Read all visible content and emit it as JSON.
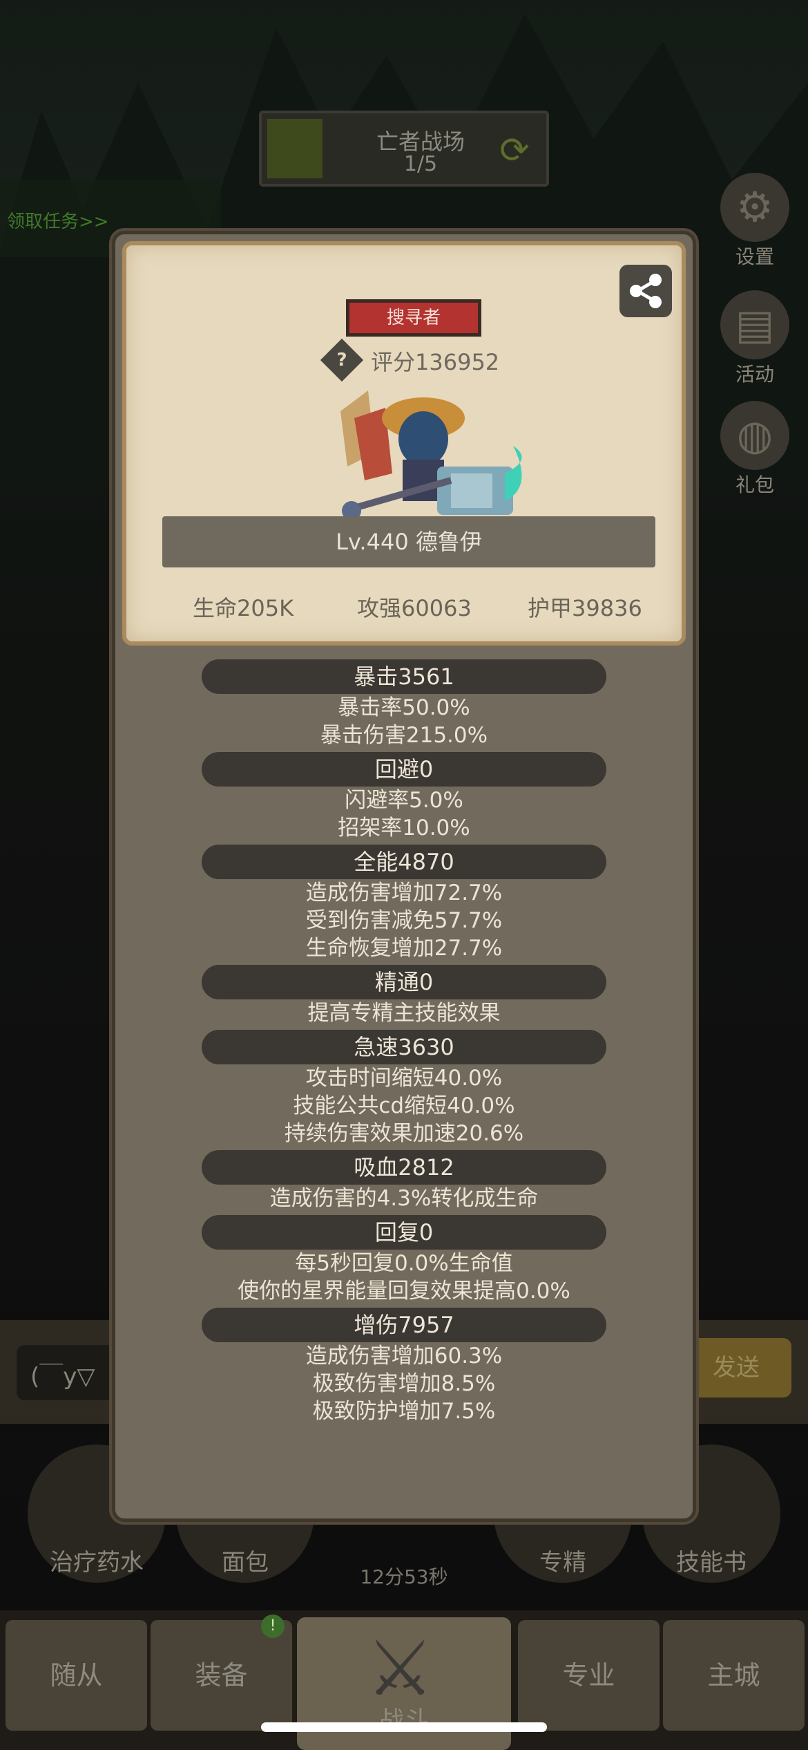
{
  "stage": {
    "title": "亡者战场",
    "progress": "1/5"
  },
  "task_link": "领取任务>>",
  "side_buttons": [
    {
      "label": "设置",
      "icon": "gear-icon"
    },
    {
      "label": "活动",
      "icon": "scroll-icon"
    },
    {
      "label": "礼包",
      "icon": "gift-icon"
    }
  ],
  "chat": {
    "input_text": "(￣y▽",
    "send_label": "发送"
  },
  "items": [
    {
      "label": "治疗药水",
      "icon": "potion-icon"
    },
    {
      "label": "面包",
      "icon": "bread-icon"
    },
    {
      "label": "专精",
      "icon": "specialty-icon"
    },
    {
      "label": "技能书",
      "icon": "skillbook-icon"
    }
  ],
  "timer": "12分53秒",
  "bottom_nav": {
    "tabs": [
      "随从",
      "装备",
      "战斗",
      "专业",
      "主城"
    ],
    "badge": "!"
  },
  "profile": {
    "role_tag": "搜寻者",
    "help_symbol": "?",
    "score": "评分136952",
    "name": "Lv.440 德鲁伊",
    "core_stats": {
      "hp": "生命205K",
      "attack": "攻强60063",
      "armor": "护甲39836"
    }
  },
  "stat_groups": [
    {
      "title": "暴击3561",
      "lines": [
        "暴击率50.0%",
        "暴击伤害215.0%"
      ]
    },
    {
      "title": "回避0",
      "lines": [
        "闪避率5.0%",
        "招架率10.0%"
      ]
    },
    {
      "title": "全能4870",
      "lines": [
        "造成伤害增加72.7%",
        "受到伤害减免57.7%",
        "生命恢复增加27.7%"
      ]
    },
    {
      "title": "精通0",
      "lines": [
        "提高专精主技能效果"
      ]
    },
    {
      "title": "急速3630",
      "lines": [
        "攻击时间缩短40.0%",
        "技能公共cd缩短40.0%",
        "持续伤害效果加速20.6%"
      ]
    },
    {
      "title": "吸血2812",
      "lines": [
        "造成伤害的4.3%转化成生命"
      ]
    },
    {
      "title": "回复0",
      "lines": [
        "每5秒回复0.0%生命值",
        "使你的星界能量回复效果提高0.0%"
      ]
    },
    {
      "title": "增伤7957",
      "lines": [
        "造成伤害增加60.3%",
        "极致伤害增加8.5%",
        "极致防护增加7.5%"
      ]
    }
  ]
}
